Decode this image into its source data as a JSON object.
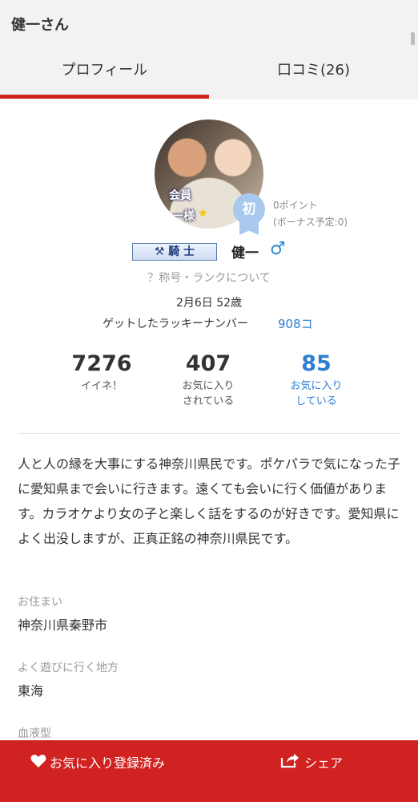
{
  "header": {
    "title": "健一さん"
  },
  "tabs": [
    {
      "label": "プロフィール",
      "active": true
    },
    {
      "label": "口コミ(26)",
      "active": false
    }
  ],
  "profile": {
    "avatar_text_1": "会員",
    "avatar_text_2": "一様",
    "badge_label": "初",
    "points_line1": "0ポイント",
    "points_line2": "(ボーナス予定:0)",
    "rank_title": "⚒ 騎 士",
    "username": "健一",
    "gender_symbol": "♂",
    "rank_help": "？称号・ランクについて",
    "birthday_age": "2月6日 52歳",
    "lucky_label": "ゲットしたラッキーナンバー",
    "lucky_value": "908コ"
  },
  "stats": [
    {
      "value": "7276",
      "label_line1": "イイネ！",
      "label_line2": ""
    },
    {
      "value": "407",
      "label_line1": "お気に入り",
      "label_line2": "されている"
    },
    {
      "value": "85",
      "label_line1": "お気に入り",
      "label_line2": "している"
    }
  ],
  "bio": "人と人の縁を大事にする神奈川県民です。ポケパラで気になった子に愛知県まで会いに行きます。遠くても会いに行く価値があります。カラオケより女の子と楽しく話をするのが好きです。愛知県によく出没しますが、正真正銘の神奈川県民です。",
  "fields": [
    {
      "label": "お住まい",
      "value": "神奈川県秦野市"
    },
    {
      "label": "よく遊びに行く地方",
      "value": "東海"
    },
    {
      "label": "血液型",
      "value": ""
    }
  ],
  "actions": {
    "favorite_label": "お気に入り登録済み",
    "share_label": "シェア"
  },
  "colors": {
    "accent": "#d02220",
    "link": "#2e7fd0",
    "badge": "#a9c8ee"
  },
  "icons": {
    "favorite": "heart-icon",
    "share": "share-icon",
    "gender": "male-icon"
  }
}
